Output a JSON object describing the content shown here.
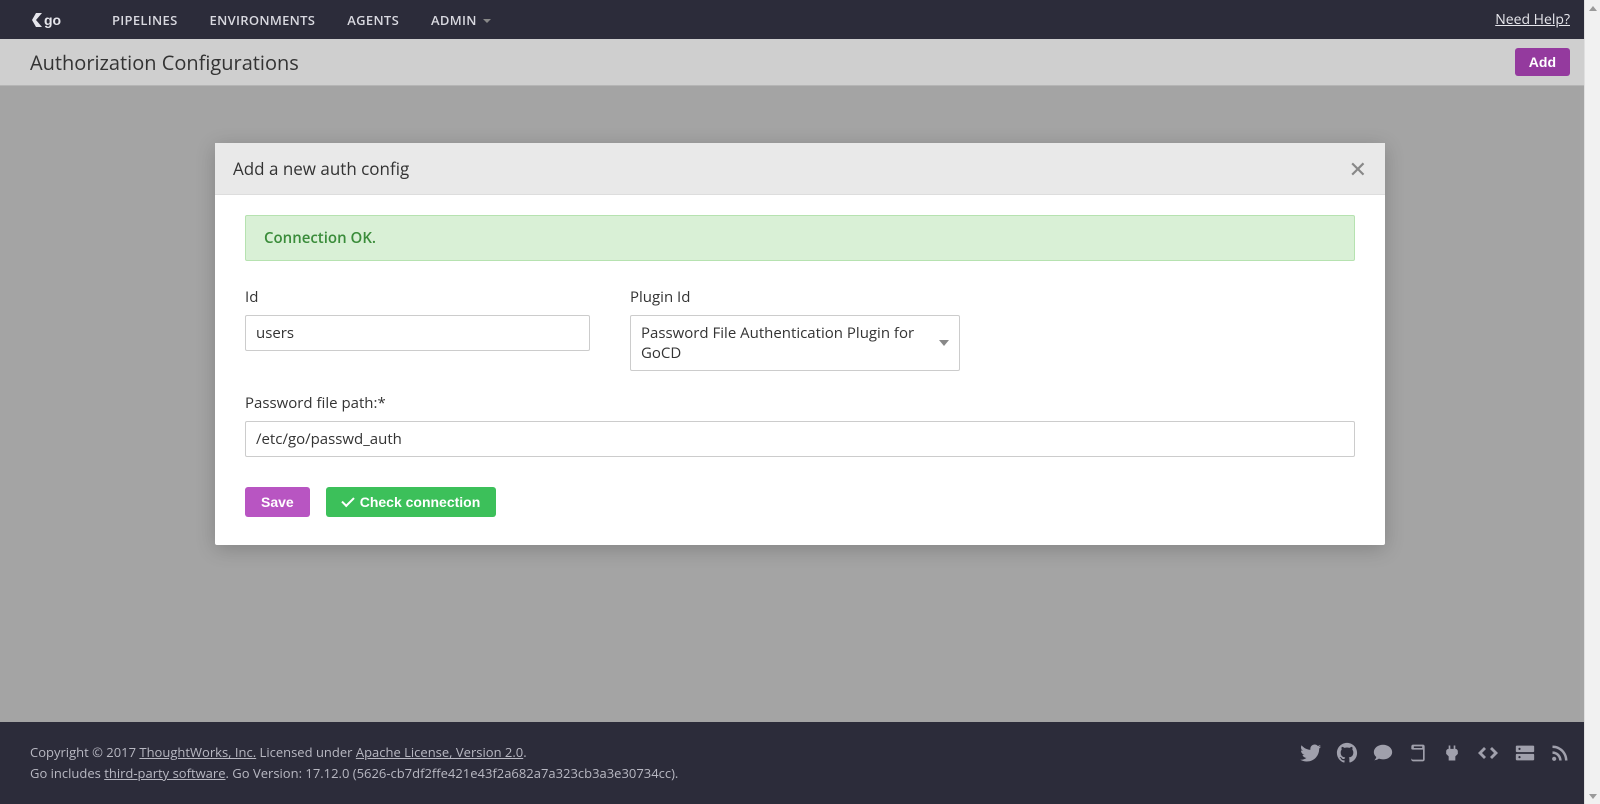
{
  "nav": {
    "items": [
      "PIPELINES",
      "ENVIRONMENTS",
      "AGENTS",
      "ADMIN"
    ],
    "help": "Need Help?"
  },
  "page": {
    "title": "Authorization Configurations",
    "add_label": "Add"
  },
  "modal": {
    "title": "Add a new auth config",
    "status": "Connection OK.",
    "fields": {
      "id_label": "Id",
      "id_value": "users",
      "plugin_label": "Plugin Id",
      "plugin_value": "Password File Authentication Plugin for GoCD",
      "path_label": "Password file path:*",
      "path_value": "/etc/go/passwd_auth"
    },
    "buttons": {
      "save": "Save",
      "check": "Check connection"
    }
  },
  "footer": {
    "copyright_prefix": "Copyright © 2017 ",
    "tw_link": "ThoughtWorks, Inc.",
    "licensed_text": " Licensed under ",
    "license_link": "Apache License, Version 2.0",
    "period": ".",
    "line2_prefix": "Go includes ",
    "third_party": "third-party software",
    "version_text": ". Go Version: 17.12.0 (5626-cb7df2ffe421e43f2a682a7a323cb3a3e30734cc)."
  }
}
